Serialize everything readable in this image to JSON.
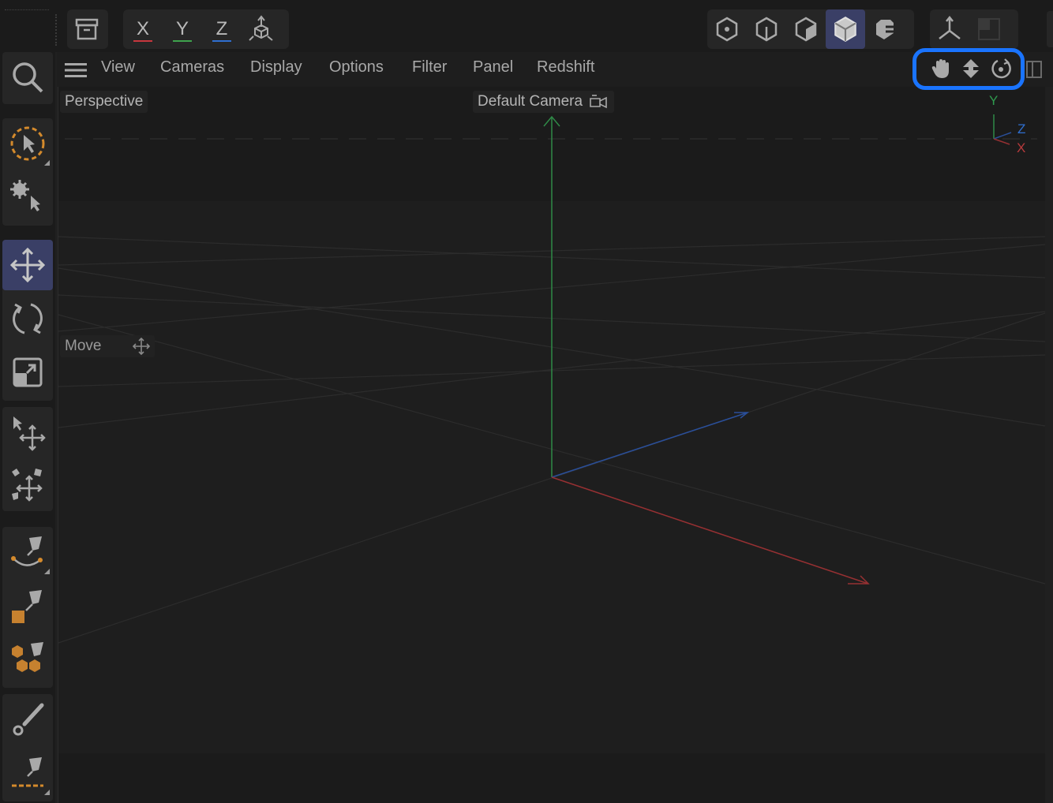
{
  "toolbar": {
    "axis_x": "X",
    "axis_y": "Y",
    "axis_z": "Z",
    "colors": {
      "x": "#c7373d",
      "y": "#3fa34d",
      "z": "#2f6fd0"
    }
  },
  "viewport_menu": {
    "items": [
      "View",
      "Cameras",
      "Display",
      "Options",
      "Filter",
      "Panel",
      "Redshift"
    ]
  },
  "viewport": {
    "projection": "Perspective",
    "camera": "Default Camera",
    "tool_hint": "Move",
    "axis_gizmo": {
      "y": "Y",
      "z": "Z",
      "x": "X"
    }
  },
  "highlight_color": "#1a74ff"
}
